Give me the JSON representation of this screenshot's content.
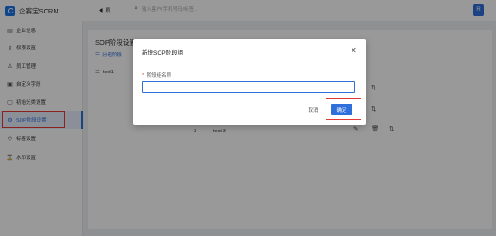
{
  "header": {
    "brand_name": "企赛宝SCRM",
    "tab_label": "刷",
    "tab_icon": "megaphone-icon",
    "search_placeholder": "输入客户/手机号码/标签...",
    "avatar_label": "R"
  },
  "sidebar": {
    "items": [
      {
        "label": "企业信息",
        "icon": "building-icon"
      },
      {
        "label": "权限设置",
        "icon": "key-icon"
      },
      {
        "label": "员工管理",
        "icon": "user-icon"
      },
      {
        "label": "自定义字段",
        "icon": "field-icon"
      },
      {
        "label": "初始分类设置",
        "icon": "category-icon"
      },
      {
        "label": "SOP阶段设置",
        "icon": "sop-icon",
        "active": true
      },
      {
        "label": "标签设置",
        "icon": "tag-icon"
      },
      {
        "label": "水印设置",
        "icon": "watermark-icon"
      }
    ],
    "footer_icon": "menu-icon"
  },
  "main": {
    "title": "SOP阶段设置",
    "tab_label": "分组阶段",
    "list_item": "test1",
    "rows": [
      {
        "index": "3",
        "name": "test-3"
      }
    ]
  },
  "modal": {
    "title": "新增SOP阶段组",
    "field_label": "阶段组名称",
    "required_mark": "*",
    "input_value": "",
    "cancel_label": "取消",
    "ok_label": "确定"
  },
  "colors": {
    "accent": "#2f6fdb",
    "highlight": "#e53935"
  }
}
